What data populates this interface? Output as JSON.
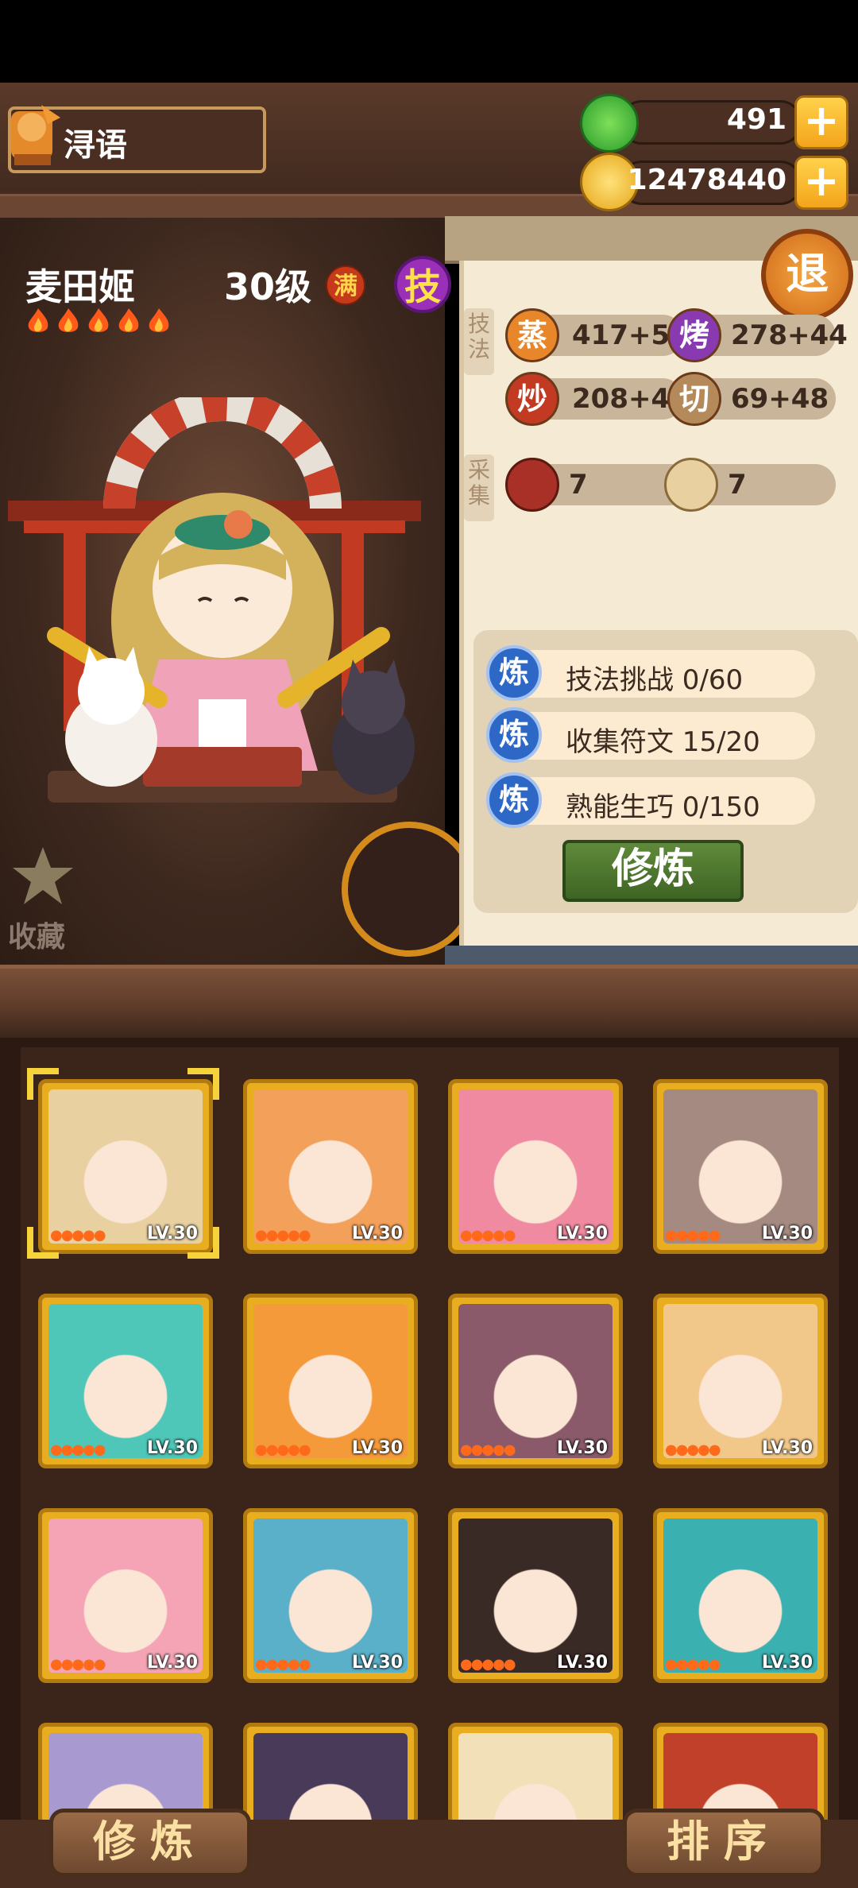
{
  "header": {
    "player_name": "浔语",
    "jade": "491",
    "coins": "12478440",
    "plus_label": "+",
    "exit_label": "退"
  },
  "hero": {
    "name": "麦田姬",
    "level": "30级",
    "full_badge": "满",
    "skill_badge": "技",
    "stars": 5
  },
  "stats": {
    "skill_label": "技法",
    "gather_label": "采集",
    "steam": {
      "icon": "蒸",
      "value": "417+52"
    },
    "roast": {
      "icon": "烤",
      "value": "278+44"
    },
    "fry": {
      "icon": "炒",
      "value": "208+44"
    },
    "cut": {
      "icon": "切",
      "value": "69+48"
    },
    "gather_meat": "7",
    "gather_flour": "7"
  },
  "tasks": [
    {
      "icon": "炼",
      "text": "技法挑战  0/60"
    },
    {
      "icon": "炼",
      "text": "收集符文  15/20"
    },
    {
      "icon": "炼",
      "text": "熟能生巧  0/150"
    }
  ],
  "train_button": "修炼",
  "favorite_label": "收藏",
  "cards": [
    {
      "lv": "LV.30",
      "color": "#e8d0a0"
    },
    {
      "lv": "LV.30",
      "color": "#f3a05a"
    },
    {
      "lv": "LV.30",
      "color": "#f08aa0"
    },
    {
      "lv": "LV.30",
      "color": "#a48a80"
    },
    {
      "lv": "LV.30",
      "color": "#4ec7b8"
    },
    {
      "lv": "LV.30",
      "color": "#f59a3a"
    },
    {
      "lv": "LV.30",
      "color": "#8a5a6a"
    },
    {
      "lv": "LV.30",
      "color": "#f2c88a"
    },
    {
      "lv": "LV.30",
      "color": "#f4a4b4"
    },
    {
      "lv": "LV.30",
      "color": "#5ab0c8"
    },
    {
      "lv": "LV.30",
      "color": "#3a2a26"
    },
    {
      "lv": "LV.30",
      "color": "#3ab0b0"
    },
    {
      "lv": "",
      "color": "#a89ad0"
    },
    {
      "lv": "",
      "color": "#4a3a5a"
    },
    {
      "lv": "",
      "color": "#f2e0b8"
    },
    {
      "lv": "",
      "color": "#c0402a"
    }
  ],
  "bottom": {
    "train_label": "修炼",
    "sort_label": "排序"
  }
}
